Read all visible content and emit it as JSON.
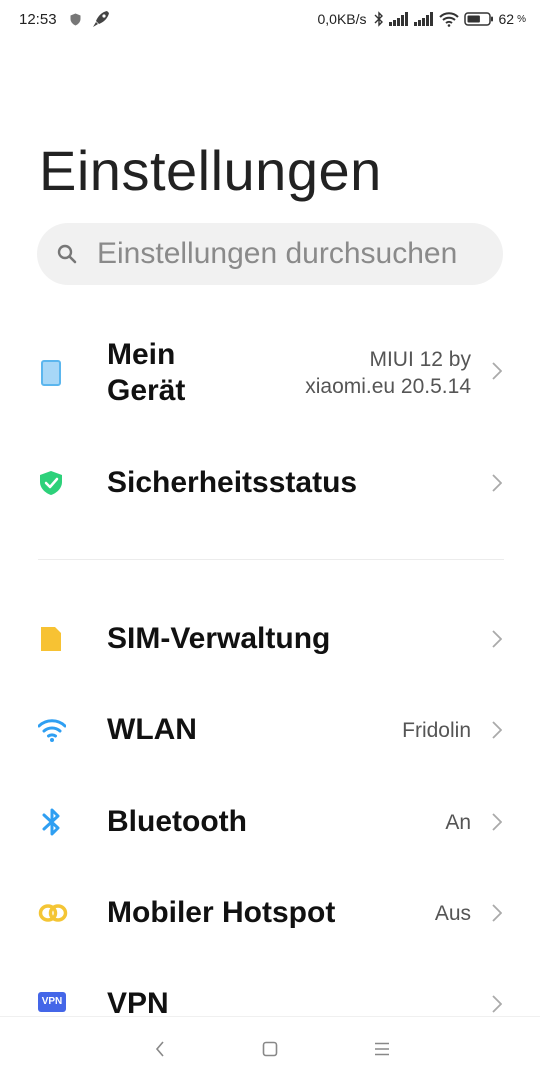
{
  "status_bar": {
    "time": "12:53",
    "net_speed": "0,0KB/s",
    "battery_level": "62",
    "battery_unit": "%",
    "icons_left": [
      "shield-icon",
      "rocket-icon"
    ],
    "icons_right": [
      "bluetooth-icon",
      "signal-icon",
      "signal-icon",
      "wifi-icon",
      "battery-icon"
    ]
  },
  "header": {
    "title": "Einstellungen"
  },
  "search": {
    "placeholder": "Einstellungen durchsuchen"
  },
  "items": [
    {
      "label_line1": "Mein",
      "label_line2": "Gerät",
      "value_line1": "MIUI 12 by",
      "value_line2": "xiaomi.eu 20.5.14",
      "icon": "device-icon",
      "icon_color": "#5bb6ee"
    },
    {
      "label": "Sicherheitsstatus",
      "value": "",
      "icon": "security-shield-icon",
      "icon_color": "#2dd17a"
    },
    {
      "label": "SIM-Verwaltung",
      "value": "",
      "icon": "sim-card-icon",
      "icon_color": "#f7c233"
    },
    {
      "label": "WLAN",
      "value": "Fridolin",
      "icon": "wifi-icon",
      "icon_color": "#2f9ff2"
    },
    {
      "label": "Bluetooth",
      "value": "An",
      "icon": "bluetooth-icon",
      "icon_color": "#2f9ff2"
    },
    {
      "label": "Mobiler Hotspot",
      "value": "Aus",
      "icon": "hotspot-icon",
      "icon_color": "#f4c535"
    },
    {
      "label": "VPN",
      "value": "",
      "icon_text": "VPN",
      "icon": "vpn-icon",
      "icon_color": "#4466e8"
    }
  ],
  "nav_bar": {
    "buttons": [
      "back-icon",
      "home-icon",
      "recents-icon"
    ]
  }
}
